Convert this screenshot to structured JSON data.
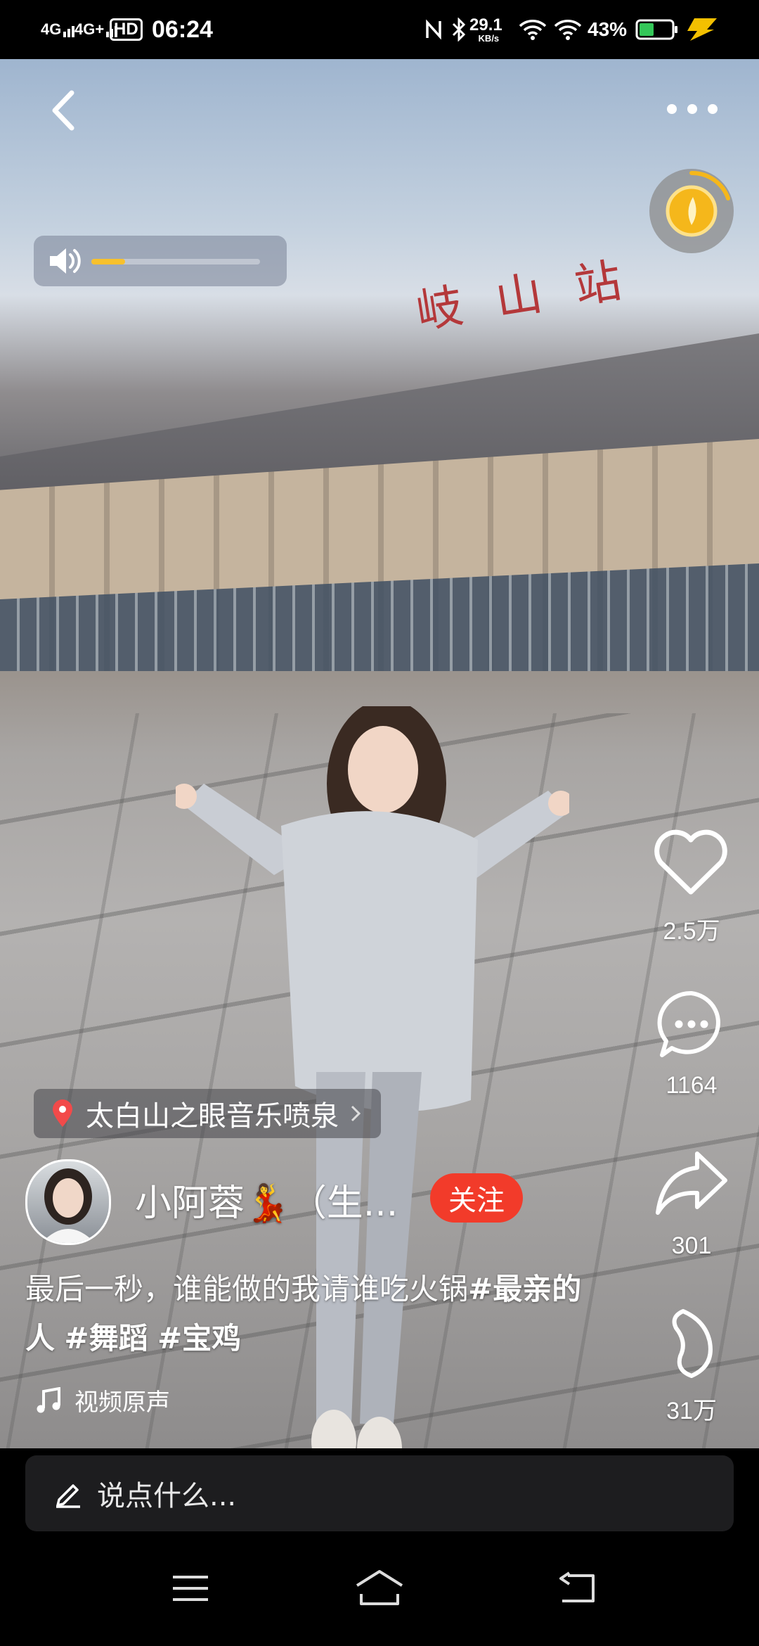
{
  "status_bar": {
    "signal_1": "4G",
    "signal_2": "4G+",
    "hd": "HD",
    "time": "06:24",
    "speed_value": "29.1",
    "speed_unit": "KB/s",
    "battery": "43%"
  },
  "video": {
    "station_sign": "岐山站",
    "volume_level": 0.2
  },
  "actions": {
    "likes": "2.5万",
    "comments": "1164",
    "shares": "301",
    "collects": "31万"
  },
  "post": {
    "location": "太白山之眼音乐喷泉",
    "author": "小阿蓉💃（生...",
    "follow_label": "关注",
    "caption_plain": "最后一秒，谁能做的我请谁吃火锅",
    "caption_tag_1": "#最亲的人",
    "caption_tag_2": "#舞蹈",
    "caption_tag_3": "#宝鸡",
    "music": "视频原声"
  },
  "comment_bar": {
    "placeholder": "说点什么..."
  },
  "colors": {
    "follow": "#f23b2a",
    "volume_fill": "#f8c12c",
    "coin": "#f5b71b"
  },
  "icons": [
    "back-icon",
    "more-icon",
    "speaker-icon",
    "coin-icon",
    "heart-icon",
    "comment-icon",
    "share-icon",
    "collect-icon",
    "location-pin-icon",
    "chevron-right-icon",
    "music-note-icon",
    "pen-icon",
    "menu-icon",
    "home-icon",
    "back-nav-icon"
  ]
}
